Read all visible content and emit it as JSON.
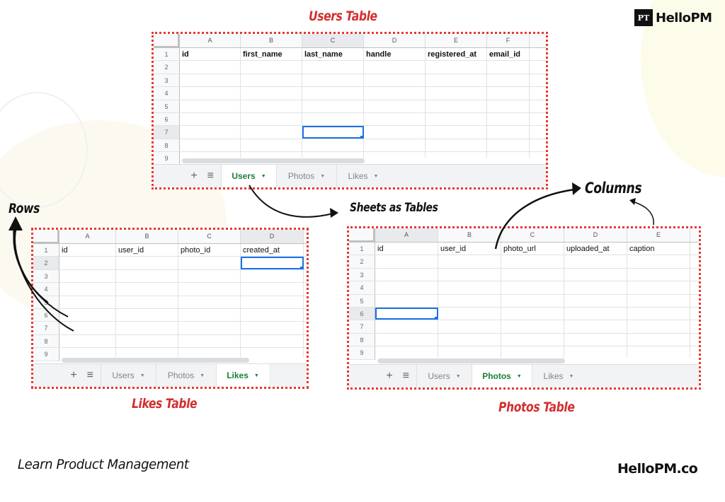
{
  "brand": {
    "logo_mark": "PT",
    "logo_text": "HelloPM",
    "footer_left": "Learn Product Management",
    "footer_right": "HelloPM.co"
  },
  "annotations": {
    "rows": "Rows",
    "columns": "Columns",
    "sheets_as_tables": "Sheets as Tables"
  },
  "colors": {
    "title_red": "#d32f2f",
    "dotted_border": "#e53935",
    "active_tab_green": "#188038",
    "selection_blue": "#1a73e8"
  },
  "sheets": {
    "users": {
      "title": "Users Table",
      "columns": [
        "A",
        "B",
        "C",
        "D",
        "E",
        "F"
      ],
      "selected_column": "C",
      "header_values": [
        "id",
        "first_name",
        "last_name",
        "handle",
        "registered_at",
        "email_id"
      ],
      "header_bold": true,
      "row_numbers": [
        "1",
        "2",
        "3",
        "4",
        "5",
        "6",
        "7",
        "8",
        "9"
      ],
      "active_cell": "C7",
      "tabs": [
        {
          "label": "Users",
          "active": true
        },
        {
          "label": "Photos",
          "active": false
        },
        {
          "label": "Likes",
          "active": false
        }
      ]
    },
    "likes": {
      "title": "Likes Table",
      "columns": [
        "A",
        "B",
        "C",
        "D"
      ],
      "selected_column": "D",
      "header_values": [
        "id",
        "user_id",
        "photo_id",
        "created_at"
      ],
      "header_bold": false,
      "row_numbers": [
        "1",
        "2",
        "3",
        "4",
        "5",
        "6",
        "7",
        "8",
        "9"
      ],
      "active_cell": "D2",
      "tabs": [
        {
          "label": "Users",
          "active": false
        },
        {
          "label": "Photos",
          "active": false
        },
        {
          "label": "Likes",
          "active": true
        }
      ]
    },
    "photos": {
      "title": "Photos Table",
      "columns": [
        "A",
        "B",
        "C",
        "D",
        "E"
      ],
      "selected_column": "A",
      "header_values": [
        "id",
        "user_id",
        "photo_url",
        "uploaded_at",
        "caption"
      ],
      "header_bold": false,
      "row_numbers": [
        "1",
        "2",
        "3",
        "4",
        "5",
        "6",
        "7",
        "8",
        "9"
      ],
      "active_cell": "A6",
      "tabs": [
        {
          "label": "Users",
          "active": false
        },
        {
          "label": "Photos",
          "active": true
        },
        {
          "label": "Likes",
          "active": false
        }
      ]
    }
  },
  "toolbar": {
    "add_sheet_icon": "+",
    "all_sheets_icon": "≡"
  }
}
